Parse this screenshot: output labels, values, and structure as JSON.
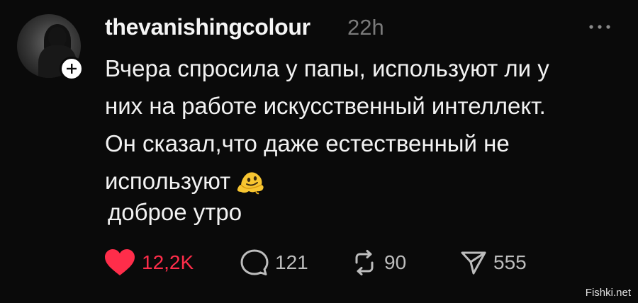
{
  "post": {
    "username": "thevanishingcolour",
    "time": "22h",
    "text_lines": [
      "Вчера спросила у папы, используют ли у",
      "них на работе искусственный интеллект.",
      "Он сказал,что даже естественный не",
      "используют"
    ],
    "text_after": "доброе утро"
  },
  "actions": {
    "likes": "12,2K",
    "replies": "121",
    "reposts": "90",
    "shares": "555"
  },
  "colors": {
    "background": "#0a0a0a",
    "like_accent": "#ff2d4a",
    "muted": "#7a7a7a"
  },
  "icons": {
    "avatar": "avatar-photo",
    "follow": "plus-icon",
    "more": "more-dots-icon",
    "emoji": "melting-face-emoji",
    "like": "heart-icon",
    "reply": "comment-bubble-icon",
    "repost": "repost-icon",
    "share": "send-icon"
  },
  "watermark": "Fishki.net"
}
